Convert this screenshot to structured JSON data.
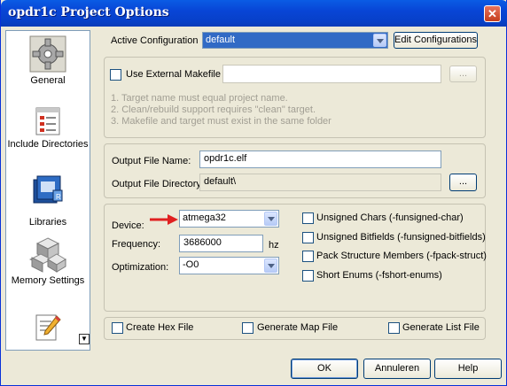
{
  "window": {
    "title": "opdr1c Project Options"
  },
  "sidebar": {
    "items": [
      {
        "label": "General"
      },
      {
        "label": "Include Directories"
      },
      {
        "label": "Libraries"
      },
      {
        "label": "Memory Settings"
      }
    ]
  },
  "config": {
    "active_label": "Active Configuration",
    "active_value": "default",
    "edit_button": "Edit Configurations"
  },
  "makefile": {
    "use_external_label": "Use External Makefile",
    "use_external_checked": false,
    "path_value": "",
    "browse_label": "...",
    "notes": [
      "1. Target name must equal project name.",
      "2. Clean/rebuild support requires  \"clean\" target.",
      "3. Makefile and target must exist in the same folder"
    ]
  },
  "output": {
    "file_name_label": "Output File Name:",
    "file_name_value": "opdr1c.elf",
    "directory_label": "Output File Directory:",
    "directory_value": "default\\",
    "browse_label": "..."
  },
  "device": {
    "device_label": "Device:",
    "device_value": "atmega32",
    "frequency_label": "Frequency:",
    "frequency_value": "3686000",
    "frequency_unit": "hz",
    "optimization_label": "Optimization:",
    "optimization_value": "-O0"
  },
  "compiler_flags": [
    {
      "label": "Unsigned Chars (-funsigned-char)",
      "checked": false
    },
    {
      "label": "Unsigned Bitfields (-funsigned-bitfields)",
      "checked": false
    },
    {
      "label": "Pack Structure Members (-fpack-struct)",
      "checked": false
    },
    {
      "label": "Short Enums (-fshort-enums)",
      "checked": false
    }
  ],
  "generate": {
    "hex_label": "Create Hex File",
    "map_label": "Generate Map File",
    "list_label": "Generate List File"
  },
  "buttons": {
    "ok": "OK",
    "cancel": "Annuleren",
    "help": "Help"
  },
  "colors": {
    "titlebar": "#0845d6",
    "dialog_bg": "#ece9d8",
    "selection": "#316ac5",
    "arrow": "#e02020"
  }
}
